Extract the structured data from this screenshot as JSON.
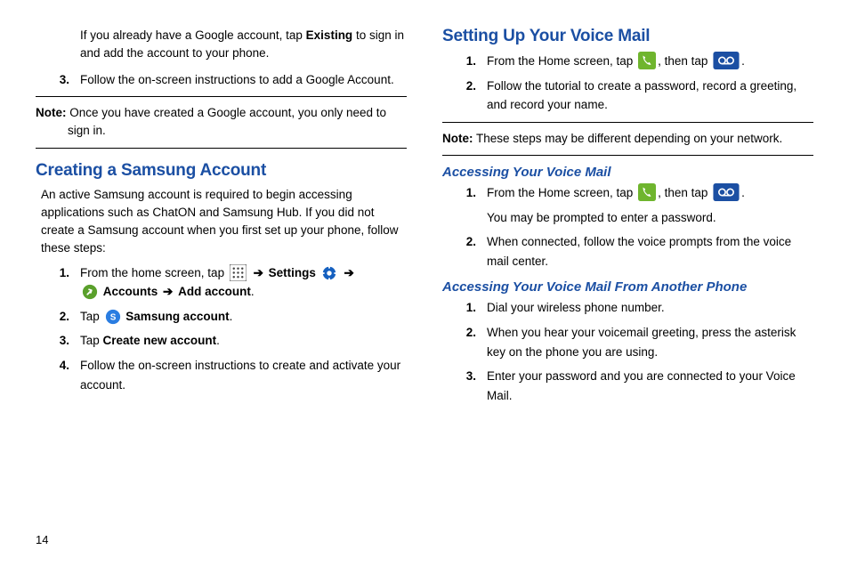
{
  "pageNumber": "14",
  "left": {
    "intro_para": "If you already have a Google account, tap ",
    "intro_bold": "Existing",
    "intro_tail": " to sign in and add the account to your phone.",
    "step3": "Follow the on-screen instructions to add a Google Account.",
    "note_label": "Note:",
    "note_text": " Once you have created a Google account, you only need to sign in.",
    "h2": "Creating a Samsung Account",
    "create_intro": "An active Samsung account is required to begin accessing applications such as ChatON and Samsung Hub. If you did not create a Samsung account when you first set up your phone, follow these steps:",
    "s1_a": "From the home screen, tap ",
    "s1_settings": "Settings",
    "s1_accounts": "Accounts",
    "s1_add": "Add account",
    "s2_a": "Tap ",
    "s2_b": "Samsung account",
    "s3_a": "Tap ",
    "s3_b": "Create new account",
    "s4": "Follow the on-screen instructions to create and activate your account."
  },
  "right": {
    "h2": "Setting Up Your Voice Mail",
    "s1_a": "From the Home screen, tap ",
    "s1_b": ", then tap ",
    "s2": "Follow the tutorial to create a password, record a greeting, and record your name.",
    "note_label": "Note:",
    "note_text": " These steps may be different depending on your network.",
    "h3a": "Accessing Your Voice Mail",
    "a1_a": "From the Home screen, tap ",
    "a1_b": ", then tap ",
    "a1_c": "You may be prompted to enter a password.",
    "a2": "When connected, follow the voice prompts from the voice mail center.",
    "h3b": "Accessing Your Voice Mail From Another Phone",
    "b1": "Dial your wireless phone number.",
    "b2": "When you hear your voicemail greeting, press the asterisk key on the phone you are using.",
    "b3": "Enter your password and you are connected to your Voice Mail."
  }
}
